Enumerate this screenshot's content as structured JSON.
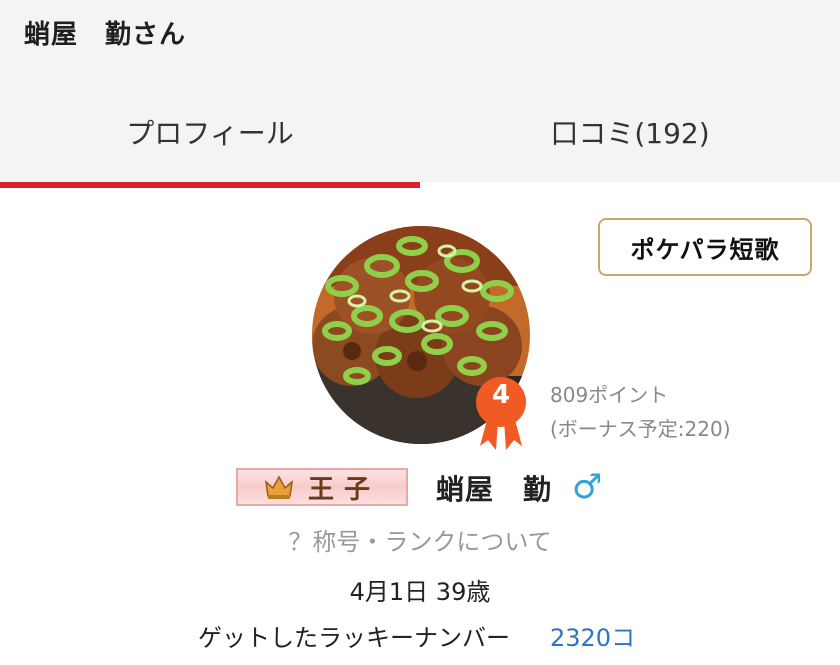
{
  "header": {
    "title": "蛸屋　勤さん"
  },
  "tabs": [
    {
      "label": "プロフィール",
      "active": true
    },
    {
      "label": "口コミ(192)",
      "active": false
    }
  ],
  "colors": {
    "accent": "#d7232b",
    "rank_badge": "#f15a22",
    "link": "#2f74c0",
    "gender": "#2fa2d6",
    "tanka_border": "#c9a867"
  },
  "profile": {
    "tanka_button": "ポケパラ短歌",
    "avatar": "takoyaki-photo",
    "rank": "4",
    "points": "809ポイント",
    "bonus": "(ボーナス予定:220)",
    "title_badge": "王子",
    "title_icon": "crown-icon",
    "name": "蛸屋　勤",
    "gender_symbol": "♂",
    "rank_help": "？称号・ランクについて",
    "birth_age": "4月1日 39歳",
    "lucky_label": "ゲットしたラッキーナンバー",
    "lucky_count": "2320コ"
  }
}
